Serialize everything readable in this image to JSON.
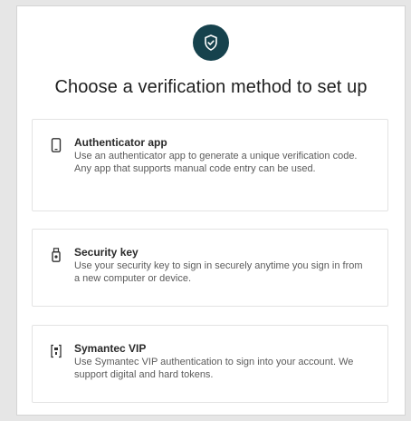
{
  "header": {
    "badge_icon": "shield-check-icon",
    "badge_color": "#16424d",
    "title": "Choose a verification method to set up"
  },
  "options": [
    {
      "icon": "phone-icon",
      "title": "Authenticator app",
      "description": "Use an authenticator app to generate a unique verification code. Any app that supports manual code entry can be used."
    },
    {
      "icon": "security-key-icon",
      "title": "Security key",
      "description": "Use your security key to sign in securely anytime you sign in from a new computer or device."
    },
    {
      "icon": "symantec-vip-icon",
      "title": "Symantec VIP",
      "description": "Use Symantec VIP authentication to sign into your account. We support digital and hard tokens."
    }
  ]
}
